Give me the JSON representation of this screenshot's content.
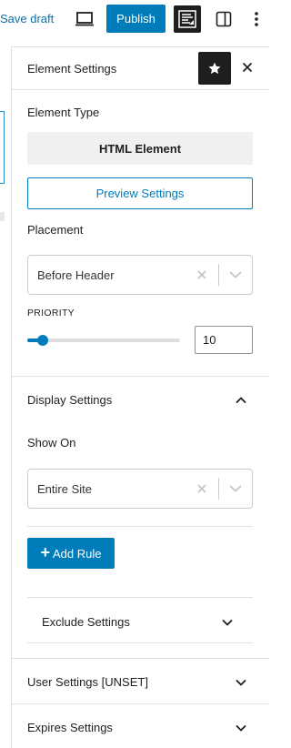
{
  "toolbar": {
    "save_draft": "Save draft",
    "preview_icon": "desktop-icon",
    "publish": "Publish",
    "plugin_icon": "generatepress-icon",
    "sidebar_toggle_icon": "sidebar-toggle-icon",
    "more_icon": "more-vertical-icon"
  },
  "panel": {
    "title": "Element Settings",
    "star_icon": "star-icon",
    "close_icon": "close-icon",
    "element_type": {
      "label": "Element Type",
      "value": "HTML Element"
    },
    "preview_settings": "Preview Settings",
    "placement": {
      "label": "Placement",
      "value": "Before Header"
    },
    "priority": {
      "label": "PRIORITY",
      "value": "10",
      "slider_fraction": 0.1
    },
    "display_settings": {
      "title": "Display Settings",
      "expanded": true,
      "show_on_label": "Show On",
      "show_on_value": "Entire Site",
      "add_rule": "Add Rule",
      "exclude_settings": "Exclude Settings"
    },
    "user_settings": "User Settings [UNSET]",
    "expires_settings": "Expires Settings"
  },
  "colors": {
    "accent": "#007cba",
    "dark": "#1e1e1e",
    "border": "#e0e0e0"
  }
}
